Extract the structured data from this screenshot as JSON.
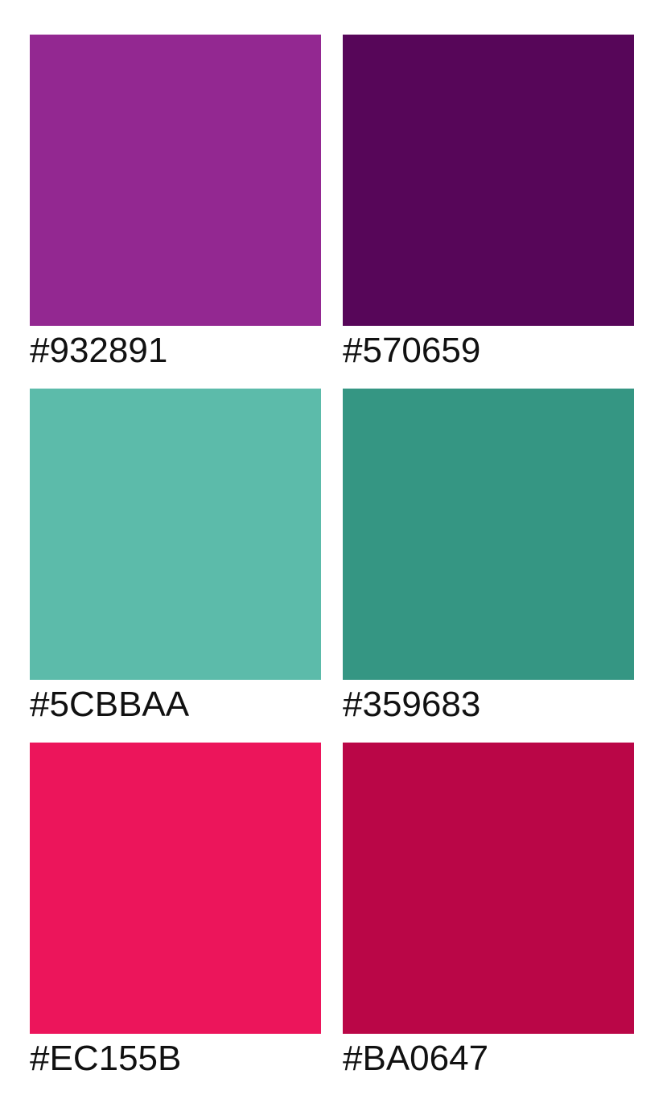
{
  "swatches": [
    {
      "color": "#932891",
      "label": "#932891"
    },
    {
      "color": "#570659",
      "label": "#570659"
    },
    {
      "color": "#5CBBAA",
      "label": "#5CBBAA"
    },
    {
      "color": "#359683",
      "label": "#359683"
    },
    {
      "color": "#EC155B",
      "label": "#EC155B"
    },
    {
      "color": "#BA0647",
      "label": "#BA0647"
    }
  ]
}
